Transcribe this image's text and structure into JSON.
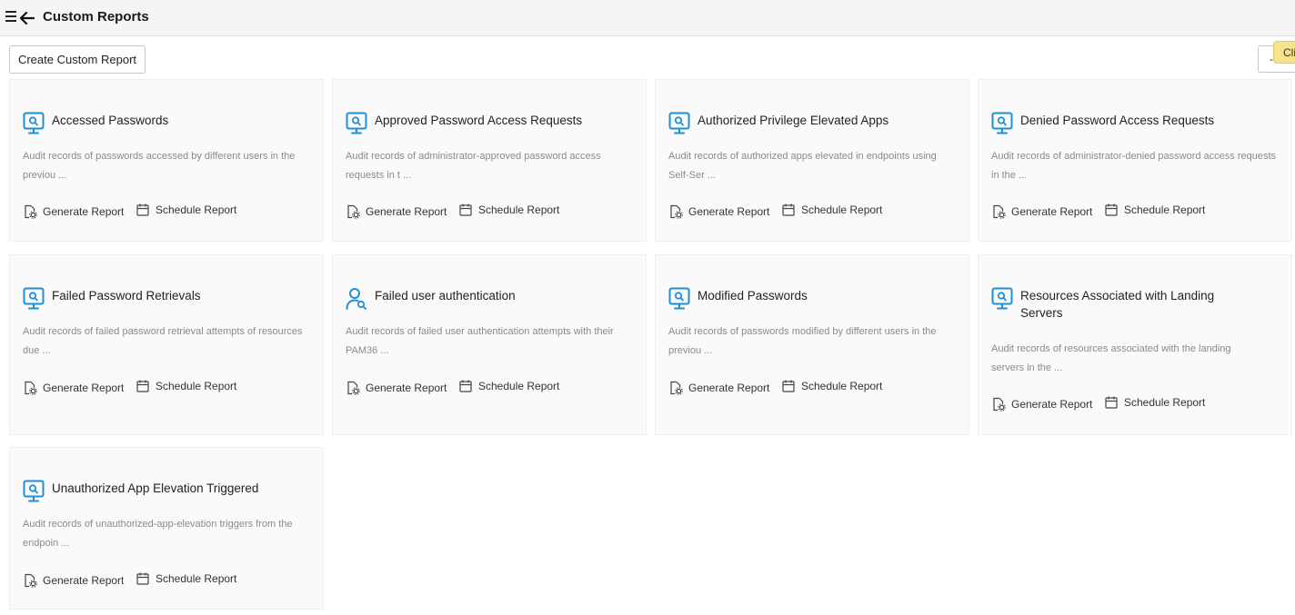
{
  "header": {
    "title": "Custom Reports",
    "menu_icon": "hamburger-menu-icon",
    "back_icon": "arrow-left-icon"
  },
  "toolbar": {
    "create_label": "Create Custom Report",
    "right_button_text": "-",
    "tooltip_text": "Cli"
  },
  "colors": {
    "accent": "#1f8fd6",
    "card_bg": "#fafafa"
  },
  "cards": [
    {
      "title": "Accessed Passwords",
      "description": "Audit records of passwords accessed by different users in the previou ...",
      "icon": "monitor-search-icon",
      "generate_label": "Generate Report",
      "schedule_label": "Schedule Report"
    },
    {
      "title": "Approved Password Access Requests",
      "description": "Audit records of administrator-approved password access requests in t ...",
      "icon": "monitor-search-icon",
      "generate_label": "Generate Report",
      "schedule_label": "Schedule Report"
    },
    {
      "title": "Authorized Privilege Elevated Apps",
      "description": "Audit records of authorized apps elevated in endpoints using Self-Ser ...",
      "icon": "monitor-search-icon",
      "generate_label": "Generate Report",
      "schedule_label": "Schedule Report"
    },
    {
      "title": "Denied Password Access Requests",
      "description": "Audit records of administrator-denied password access requests in the ...",
      "icon": "monitor-search-icon",
      "generate_label": "Generate Report",
      "schedule_label": "Schedule Report"
    },
    {
      "title": "Failed Password Retrievals",
      "description": "Audit records of failed password retrieval attempts of resources due ...",
      "icon": "monitor-search-icon",
      "generate_label": "Generate Report",
      "schedule_label": "Schedule Report"
    },
    {
      "title": "Failed user authentication",
      "description": "Audit records of failed user authentication attempts with their PAM36 ...",
      "icon": "user-search-icon",
      "generate_label": "Generate Report",
      "schedule_label": "Schedule Report"
    },
    {
      "title": "Modified Passwords",
      "description": "Audit records of passwords modified by different users in the previou ...",
      "icon": "monitor-search-icon",
      "generate_label": "Generate Report",
      "schedule_label": "Schedule Report"
    },
    {
      "title": "Resources Associated with Landing Servers",
      "description": "Audit records of resources associated with the landing servers in the ...",
      "icon": "monitor-search-icon",
      "generate_label": "Generate Report",
      "schedule_label": "Schedule Report"
    },
    {
      "title": "Unauthorized App Elevation Triggered",
      "description": "Audit records of unauthorized-app-elevation triggers from the endpoin ...",
      "icon": "monitor-search-icon",
      "generate_label": "Generate Report",
      "schedule_label": "Schedule Report"
    }
  ]
}
